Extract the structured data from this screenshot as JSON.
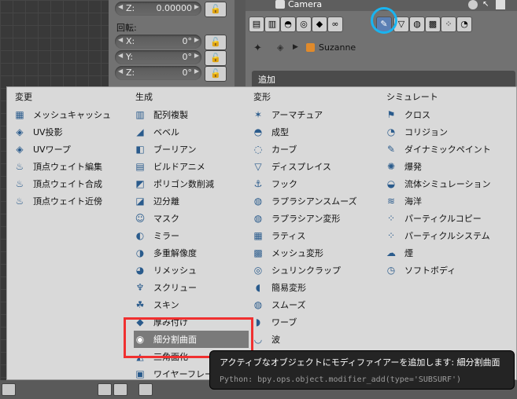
{
  "npanel": {
    "fields": [
      {
        "label": "Z:",
        "value": "0.00000"
      },
      {
        "label": "X:",
        "value": "0°"
      },
      {
        "label": "Y:",
        "value": "0°"
      },
      {
        "label": "Z:",
        "value": "0°"
      }
    ],
    "rotation_label": "回転:"
  },
  "props": {
    "camera_label": "Camera",
    "object_name": "Suzanne",
    "add_label": "追加"
  },
  "menu": {
    "columns": [
      {
        "title": "変更",
        "items": [
          {
            "label": "メッシュキャッシュ",
            "icon": "mesh-cache-icon",
            "glyph": "▦"
          },
          {
            "label": "UV投影",
            "icon": "uv-project-icon",
            "glyph": "◈"
          },
          {
            "label": "UVワープ",
            "icon": "uv-warp-icon",
            "glyph": "◈"
          },
          {
            "label": "頂点ウェイト編集",
            "icon": "vertex-weight-icon",
            "glyph": "♨"
          },
          {
            "label": "頂点ウェイト合成",
            "icon": "vertex-weight-icon",
            "glyph": "♨"
          },
          {
            "label": "頂点ウェイト近傍",
            "icon": "vertex-weight-icon",
            "glyph": "♨"
          }
        ]
      },
      {
        "title": "生成",
        "items": [
          {
            "label": "配列複製",
            "icon": "array-icon",
            "glyph": "▥"
          },
          {
            "label": "ベベル",
            "icon": "bevel-icon",
            "glyph": "◢"
          },
          {
            "label": "ブーリアン",
            "icon": "boolean-icon",
            "glyph": "◧"
          },
          {
            "label": "ビルドアニメ",
            "icon": "build-icon",
            "glyph": "▤"
          },
          {
            "label": "ポリゴン数削減",
            "icon": "decimate-icon",
            "glyph": "◩"
          },
          {
            "label": "辺分離",
            "icon": "edge-split-icon",
            "glyph": "◪"
          },
          {
            "label": "マスク",
            "icon": "mask-icon",
            "glyph": "☺"
          },
          {
            "label": "ミラー",
            "icon": "mirror-icon",
            "glyph": "◐"
          },
          {
            "label": "多重解像度",
            "icon": "multires-icon",
            "glyph": "◑"
          },
          {
            "label": "リメッシュ",
            "icon": "remesh-icon",
            "glyph": "◕"
          },
          {
            "label": "スクリュー",
            "icon": "screw-icon",
            "glyph": "♆"
          },
          {
            "label": "スキン",
            "icon": "skin-icon",
            "glyph": "☘"
          },
          {
            "label": "厚み付け",
            "icon": "solidify-icon",
            "glyph": "◆"
          },
          {
            "label": "細分割曲面",
            "icon": "subsurf-icon",
            "glyph": "◉",
            "hover": true
          },
          {
            "label": "三角面化",
            "icon": "triangulate-icon",
            "glyph": "◭"
          },
          {
            "label": "ワイヤーフレーム",
            "icon": "wireframe-icon",
            "glyph": "▣"
          }
        ]
      },
      {
        "title": "変形",
        "items": [
          {
            "label": "アーマチュア",
            "icon": "armature-icon",
            "glyph": "✶"
          },
          {
            "label": "成型",
            "icon": "cast-icon",
            "glyph": "◓"
          },
          {
            "label": "カーブ",
            "icon": "curve-icon",
            "glyph": "◌"
          },
          {
            "label": "ディスプレイス",
            "icon": "displace-icon",
            "glyph": "▽"
          },
          {
            "label": "フック",
            "icon": "hook-icon",
            "glyph": "⚓"
          },
          {
            "label": "ラプラシアンスムーズ",
            "icon": "laplacian-smooth-icon",
            "glyph": "◍"
          },
          {
            "label": "ラプラシアン変形",
            "icon": "laplacian-deform-icon",
            "glyph": "◍"
          },
          {
            "label": "ラティス",
            "icon": "lattice-icon",
            "glyph": "▦"
          },
          {
            "label": "メッシュ変形",
            "icon": "mesh-deform-icon",
            "glyph": "▩"
          },
          {
            "label": "シュリンクラップ",
            "icon": "shrinkwrap-icon",
            "glyph": "◎"
          },
          {
            "label": "簡易変形",
            "icon": "simple-deform-icon",
            "glyph": "◖"
          },
          {
            "label": "スムーズ",
            "icon": "smooth-icon",
            "glyph": "◍"
          },
          {
            "label": "ワーブ",
            "icon": "warp-icon",
            "glyph": "◗"
          },
          {
            "label": "波",
            "icon": "wave-icon",
            "glyph": "◡"
          }
        ]
      },
      {
        "title": "シミュレート",
        "items": [
          {
            "label": "クロス",
            "icon": "cloth-icon",
            "glyph": "⚑"
          },
          {
            "label": "コリジョン",
            "icon": "collision-icon",
            "glyph": "◔"
          },
          {
            "label": "ダイナミックペイント",
            "icon": "dynamic-paint-icon",
            "glyph": "✎"
          },
          {
            "label": "爆発",
            "icon": "explode-icon",
            "glyph": "✺"
          },
          {
            "label": "流体シミュレーション",
            "icon": "fluid-icon",
            "glyph": "◒"
          },
          {
            "label": "海洋",
            "icon": "ocean-icon",
            "glyph": "≋"
          },
          {
            "label": "パーティクルコピー",
            "icon": "particle-instance-icon",
            "glyph": "⁘"
          },
          {
            "label": "パーティクルシステム",
            "icon": "particle-system-icon",
            "glyph": "⁘"
          },
          {
            "label": "煙",
            "icon": "smoke-icon",
            "glyph": "☁"
          },
          {
            "label": "ソフトボディ",
            "icon": "soft-body-icon",
            "glyph": "◷"
          }
        ]
      }
    ]
  },
  "tooltip": {
    "title": "アクティブなオブジェクトにモディファイアーを追加します: 細分割曲面",
    "python": "Python: bpy.ops.object.modifier_add(type='SUBSURF')"
  },
  "colors": {
    "highlight_circle": "#19b4f0",
    "red_box": "#f03030",
    "hover": "#7a7a7a"
  }
}
